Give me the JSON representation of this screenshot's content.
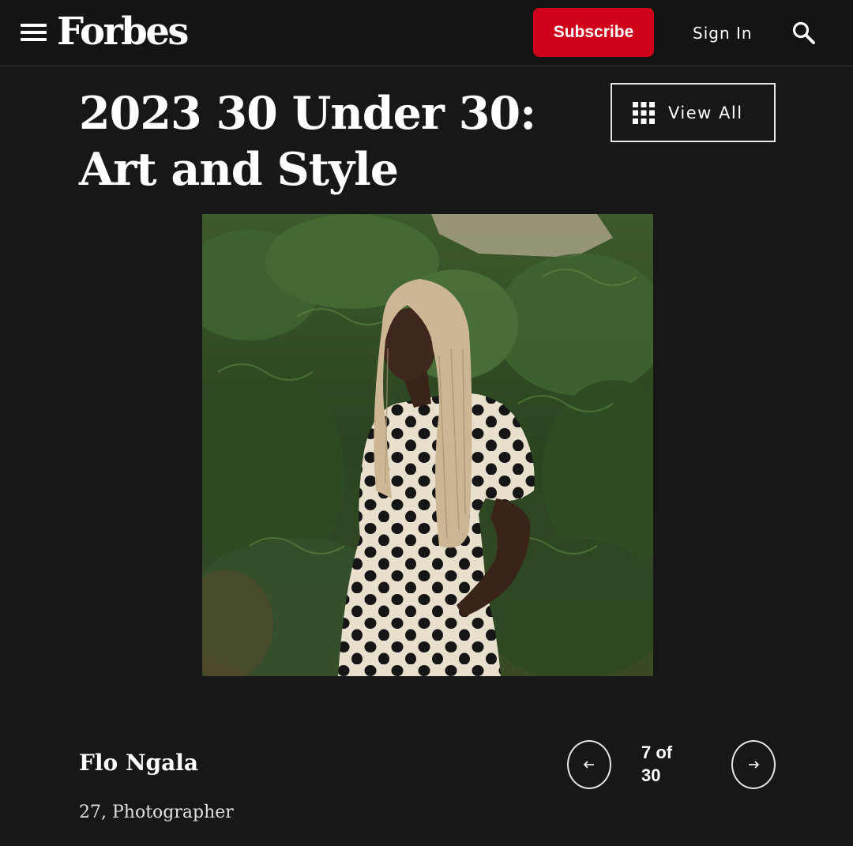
{
  "header": {
    "logo": "Forbes",
    "subscribe_label": "Subscribe",
    "signin_label": "Sign In",
    "icons": [
      "menu-icon",
      "search-icon"
    ],
    "subscribe_color": "#d0021b"
  },
  "gallery": {
    "title": "2023 30 Under 30: Art and Style",
    "view_all_label": "View All"
  },
  "slide": {
    "name": "Flo Ngala",
    "description": "27, Photographer",
    "counter_current": "7 of",
    "counter_total": "30"
  },
  "colors": {
    "background": "#181717",
    "topbar": "#141414",
    "accent": "#d0021b"
  }
}
